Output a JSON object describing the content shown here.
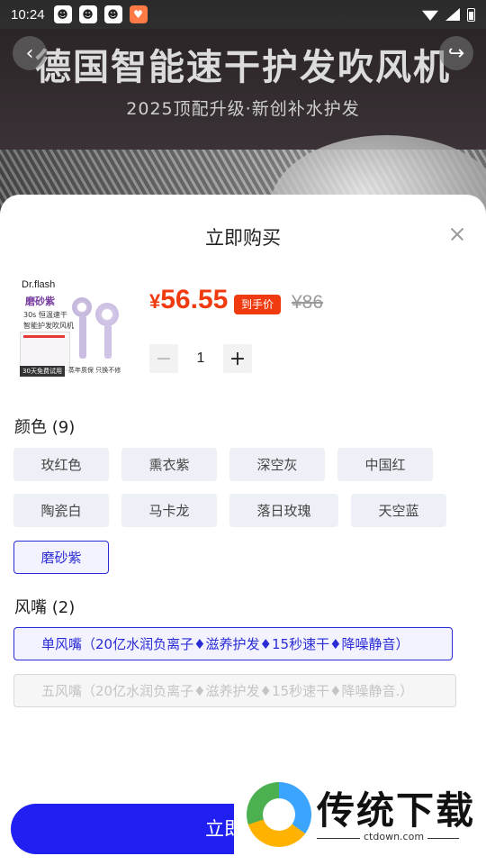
{
  "status_bar": {
    "time": "10:24",
    "icons": [
      "robot-app-icon",
      "robot-app-icon",
      "robot-app-icon",
      "heart-app-icon"
    ]
  },
  "background": {
    "title": "德国智能速干护发吹风机",
    "subtitle": "2025顶配升级·新创补水护发"
  },
  "nav": {
    "back_icon": "‹",
    "share_icon": "↪"
  },
  "sheet": {
    "title": "立即购买",
    "close_icon": "close-icon"
  },
  "product": {
    "thumb": {
      "brand": "Dr.flash",
      "variant": "磨砂紫",
      "line1": "30s 恒温速干",
      "line2": "智能护发吹风机",
      "footer_left": "30天免费试用",
      "footer_right": "蒸年质保 只换不修"
    },
    "price_symbol": "¥",
    "price": "56.55",
    "price_badge": "到手价",
    "original_price": "¥86"
  },
  "quantity": {
    "minus": "−",
    "value": "1",
    "plus": "+"
  },
  "colors_section": {
    "label": "颜色 (9)",
    "options": [
      "玫红色",
      "熏衣紫",
      "深空灰",
      "中国红",
      "陶瓷白",
      "马卡龙",
      "落日玫瑰",
      "天空蓝",
      "磨砂紫"
    ],
    "selected": "磨砂紫"
  },
  "nozzle_section": {
    "label": "风嘴 (2)",
    "options": [
      "单风嘴（20亿水润负离子♦滋养护发♦15秒速干♦降噪静音）",
      "五风嘴（20亿水润负离子♦滋养护发♦15秒速干♦降噪静音.）"
    ],
    "selected": "单风嘴（20亿水润负离子♦滋养护发♦15秒速干♦降噪静音）"
  },
  "buy_button": {
    "label": "立即购买"
  },
  "watermark": {
    "text": "传统下载",
    "url": "ctdown.com"
  },
  "theme": {
    "accent": "#1f1ff2",
    "price_color": "#f03a0f"
  }
}
